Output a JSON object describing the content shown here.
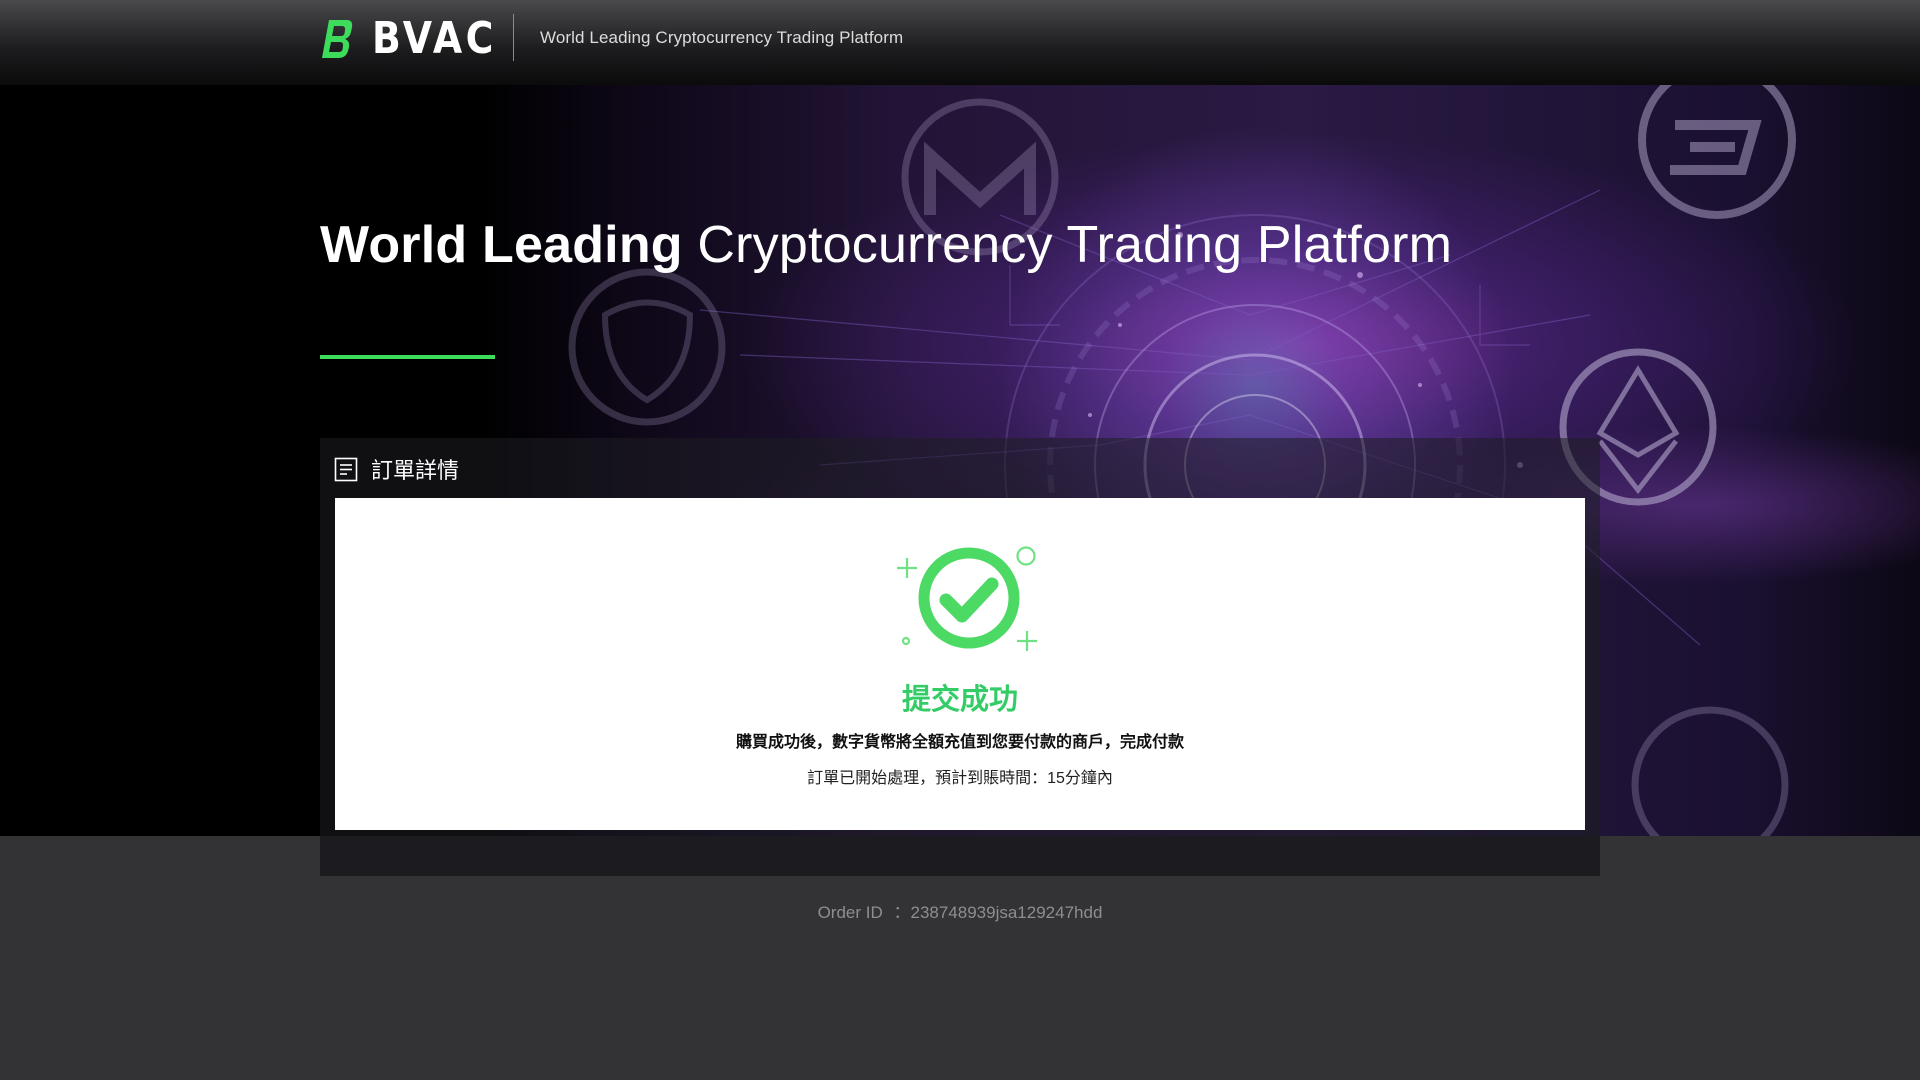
{
  "header": {
    "brand": "BVAC",
    "logo_icon": "bvac-logo-icon",
    "tagline": "World Leading Cryptocurrency Trading Platform"
  },
  "hero": {
    "title_bold": "World Leading",
    "title_light": "Cryptocurrency Trading Platform",
    "accent_color": "#3ddc5b"
  },
  "order": {
    "panel_title": "訂單詳情",
    "panel_icon": "document-icon",
    "status_icon": "success-check-icon",
    "status_title": "提交成功",
    "status_message": "購買成功後，數字貨幣將全額充值到您要付款的商戶，完成付款",
    "status_detail": "訂單已開始處理，預計到賬時間：15分鐘內",
    "order_id_label": "Order ID ",
    "order_id_sep": "：",
    "order_id_value": "238748939jsa129247hdd"
  },
  "colors": {
    "brand_green": "#3ddc5b",
    "success_green": "#33cc66",
    "page_bg": "#333234"
  }
}
